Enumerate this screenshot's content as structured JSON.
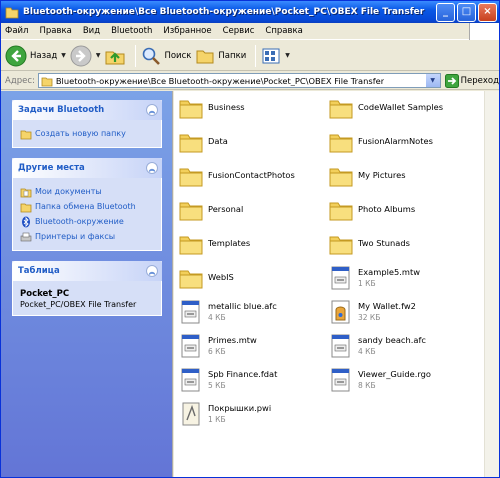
{
  "window": {
    "title": "Bluetooth-окружение\\Все Bluetooth-окружение\\Pocket_PC\\OBEX File Transfer"
  },
  "menu": [
    "Файл",
    "Правка",
    "Вид",
    "Bluetooth",
    "Избранное",
    "Сервис",
    "Справка"
  ],
  "toolbar": {
    "back_label": "Назад",
    "search_label": "Поиск",
    "folders_label": "Папки"
  },
  "address": {
    "label": "Адрес:",
    "value": "Bluetooth-окружение\\Все Bluetooth-окружение\\Pocket_PC\\OBEX File Transfer",
    "go_label": "Переход"
  },
  "tasks": {
    "title": "Задачи Bluetooth",
    "items": [
      {
        "label": "Создать новую папку",
        "icon": "folder-icon"
      }
    ]
  },
  "places": {
    "title": "Другие места",
    "items": [
      {
        "label": "Мои документы",
        "icon": "documents-folder-icon"
      },
      {
        "label": "Папка обмена Bluetooth",
        "icon": "folder-icon"
      },
      {
        "label": "Bluetooth-окружение",
        "icon": "bluetooth-icon"
      },
      {
        "label": "Принтеры и факсы",
        "icon": "printer-icon"
      }
    ]
  },
  "details": {
    "title": "Таблица",
    "name": "Pocket_PC",
    "sub": "Pocket_PC/OBEX File Transfer"
  },
  "files": [
    {
      "name": "Business",
      "size": "",
      "type": "folder"
    },
    {
      "name": "CodeWallet Samples",
      "size": "",
      "type": "folder"
    },
    {
      "name": "Data",
      "size": "",
      "type": "folder"
    },
    {
      "name": "FusionAlarmNotes",
      "size": "",
      "type": "folder"
    },
    {
      "name": "FusionContactPhotos",
      "size": "",
      "type": "folder"
    },
    {
      "name": "My Pictures",
      "size": "",
      "type": "folder"
    },
    {
      "name": "Personal",
      "size": "",
      "type": "folder"
    },
    {
      "name": "Photo Albums",
      "size": "",
      "type": "folder"
    },
    {
      "name": "Templates",
      "size": "",
      "type": "folder"
    },
    {
      "name": "Two Stunads",
      "size": "",
      "type": "folder"
    },
    {
      "name": "WebIS",
      "size": "",
      "type": "folder"
    },
    {
      "name": "Example5.mtw",
      "size": "1 КБ",
      "type": "file"
    },
    {
      "name": "metallic blue.afc",
      "size": "4 КБ",
      "type": "file"
    },
    {
      "name": "My Wallet.fw2",
      "size": "32 КБ",
      "type": "wallet"
    },
    {
      "name": "Primes.mtw",
      "size": "6 КБ",
      "type": "file"
    },
    {
      "name": "sandy beach.afc",
      "size": "4 КБ",
      "type": "file"
    },
    {
      "name": "Spb Finance.fdat",
      "size": "5 КБ",
      "type": "file"
    },
    {
      "name": "Viewer_Guide.rgo",
      "size": "8 КБ",
      "type": "file"
    },
    {
      "name": "Покрышки.pwi",
      "size": "1 КБ",
      "type": "pwi"
    }
  ]
}
